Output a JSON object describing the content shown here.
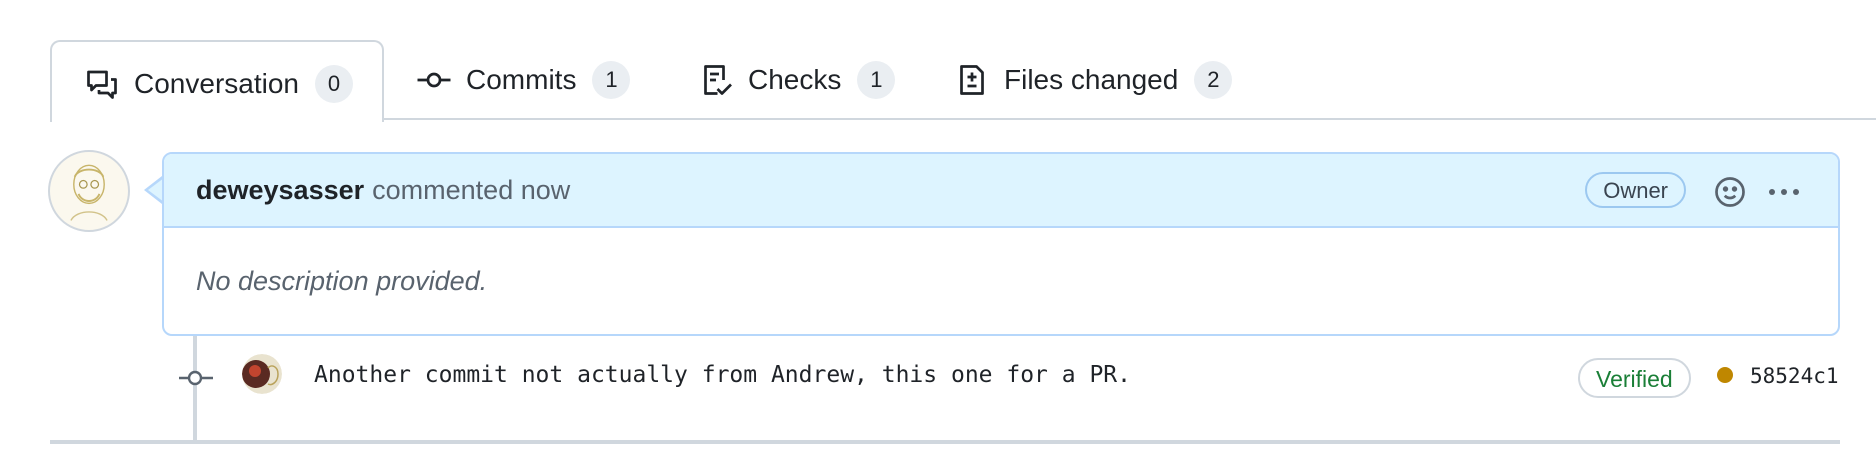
{
  "tabs": [
    {
      "label": "Conversation",
      "count": "0",
      "icon": "comment-discussion-icon",
      "active": true
    },
    {
      "label": "Commits",
      "count": "1",
      "icon": "git-commit-icon",
      "active": false
    },
    {
      "label": "Checks",
      "count": "1",
      "icon": "checklist-icon",
      "active": false
    },
    {
      "label": "Files changed",
      "count": "2",
      "icon": "file-diff-icon",
      "active": false
    }
  ],
  "comment": {
    "author": "deweysasser",
    "meta": "commented now",
    "role_badge": "Owner",
    "body": "No description provided."
  },
  "commit": {
    "message": "Another commit not actually from Andrew, this one for a PR.",
    "verified_label": "Verified",
    "sha": "58524c1",
    "status_color": "#bf8700"
  },
  "colors": {
    "border": "#d0d7de",
    "comment_header_bg": "#ddf4ff",
    "comment_border": "#b6d7fb",
    "verified_green": "#1a7f37"
  }
}
